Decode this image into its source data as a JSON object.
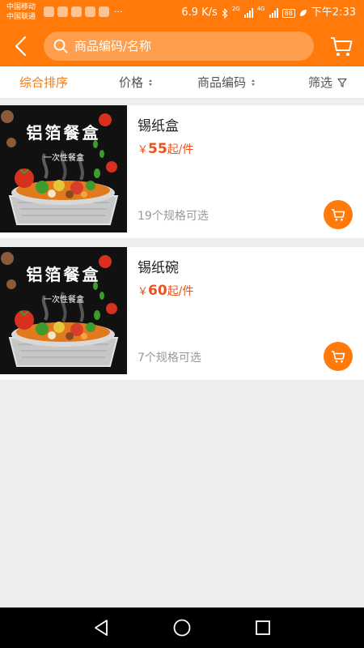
{
  "status_bar": {
    "carrier1": "中国移动",
    "carrier2": "中国联通",
    "more": "···",
    "speed": "6.9 K/s",
    "net1": "2G",
    "net2": "4G",
    "battery": "88",
    "time": "下午2:33"
  },
  "header": {
    "search_placeholder": "商品编码/名称",
    "back_icon": "chevron-left-icon",
    "cart_icon": "cart-icon"
  },
  "sort_bar": {
    "items": [
      {
        "label": "综合排序",
        "active": true
      },
      {
        "label": "价格"
      },
      {
        "label": "商品编码"
      },
      {
        "label": "筛选"
      }
    ]
  },
  "products": [
    {
      "name": "锡纸盒",
      "currency": "￥",
      "price": "55",
      "unit": "起/件",
      "specs": "19个规格可选",
      "image_title": "铝箔餐盒",
      "image_subtitle": "一次性餐盒"
    },
    {
      "name": "锡纸碗",
      "currency": "￥",
      "price": "60",
      "unit": "起/件",
      "specs": "7个规格可选",
      "image_title": "铝箔餐盒",
      "image_subtitle": "一次性餐盒"
    }
  ],
  "colors": {
    "brand": "#ff7a0a",
    "price": "#e8531f",
    "active_sort": "#ef7a16",
    "background": "#eeeeee"
  }
}
